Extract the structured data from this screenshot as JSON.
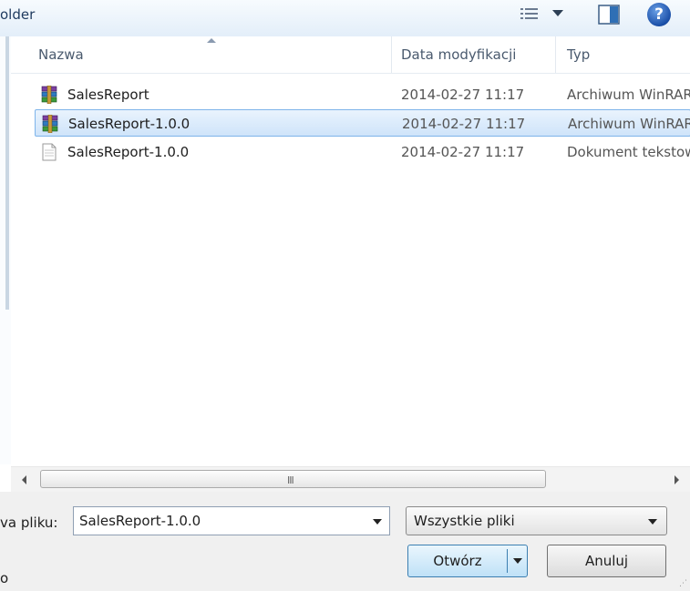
{
  "toolbar": {
    "label": "older",
    "icons": [
      "view-menu-icon",
      "preview-pane-icon",
      "help-icon"
    ],
    "help_glyph": "?"
  },
  "columns": {
    "name": "Nazwa",
    "date": "Data modyfikacji",
    "type": "Typ"
  },
  "files": [
    {
      "name": "SalesReport",
      "date": "2014-02-27 11:17",
      "type": "Archiwum WinRAR",
      "icon": "winrar-archive-icon",
      "selected": false
    },
    {
      "name": "SalesReport-1.0.0",
      "date": "2014-02-27 11:17",
      "type": "Archiwum WinRAR",
      "icon": "winrar-archive-icon",
      "selected": true
    },
    {
      "name": "SalesReport-1.0.0",
      "date": "2014-02-27 11:17",
      "type": "Dokument tekstowy",
      "icon": "text-document-icon",
      "selected": false
    }
  ],
  "scrollbar": {
    "grip": "III"
  },
  "bottom": {
    "filename_label": "va pliku:",
    "filename_value": "SalesReport-1.0.0",
    "filter_value": "Wszystkie pliki",
    "open_label": "Otwórz",
    "cancel_label": "Anuluj",
    "left_char": "o"
  },
  "colors": {
    "selection_border": "#7eb4ea",
    "selection_fill": "#cfe4fa",
    "open_button_border": "#3c7fb1"
  }
}
